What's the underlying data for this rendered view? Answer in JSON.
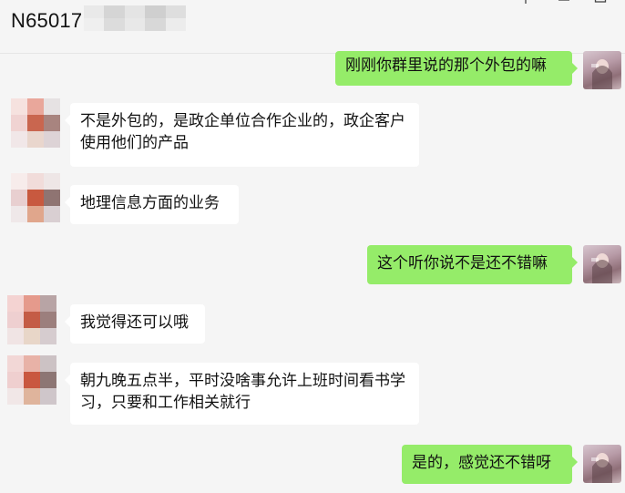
{
  "chat": {
    "title": "N65017"
  },
  "header": {
    "icons": [
      "pin-icon",
      "minimize-icon",
      "maximize-icon"
    ]
  },
  "colors": {
    "background": "#f5f5f5",
    "left_bubble": "#ffffff",
    "right_bubble": "#95ec69",
    "text": "#111111"
  },
  "messages": [
    {
      "side": "right",
      "text": "刚刚你群里说的那个外包的嘛"
    },
    {
      "side": "left",
      "text": "不是外包的，是政企单位合作企业的，政企客户使用他们的产品"
    },
    {
      "side": "left",
      "text": "地理信息方面的业务"
    },
    {
      "side": "right",
      "text": "这个听你说不是还不错嘛"
    },
    {
      "side": "left",
      "text": "我觉得还可以哦"
    },
    {
      "side": "left",
      "text": "朝九晚五点半，平时没啥事允许上班时间看书学习，只要和工作相关就行"
    },
    {
      "side": "right",
      "text": "是的，感觉还不错呀"
    }
  ]
}
